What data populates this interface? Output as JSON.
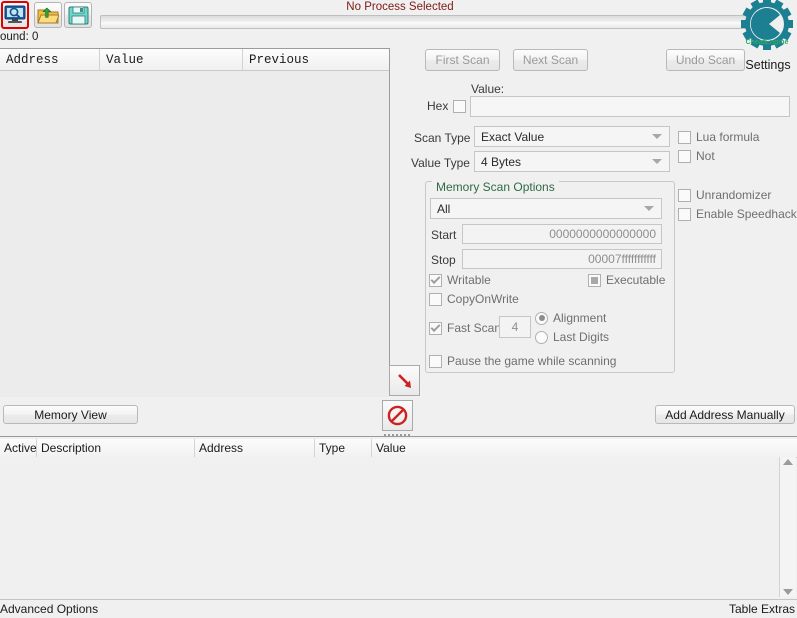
{
  "window": {
    "process_status": "No Process Selected",
    "found_label": "ound: 0",
    "settings_label": "Settings"
  },
  "toolbar": {
    "icons": [
      {
        "name": "open-process-icon",
        "label": "Open Process"
      },
      {
        "name": "open-file-icon",
        "label": "Open File"
      },
      {
        "name": "save-file-icon",
        "label": "Save File"
      }
    ]
  },
  "scan_results": {
    "columns": [
      "Address",
      "Value",
      "Previous"
    ],
    "rows": []
  },
  "scan_buttons": {
    "first_scan": "First Scan",
    "next_scan": "Next Scan",
    "undo_scan": "Undo Scan"
  },
  "scan_form": {
    "value_label": "Value:",
    "hex_label": "Hex",
    "hex_checked": false,
    "value_input": "",
    "scan_type_label": "Scan Type",
    "scan_type_value": "Exact Value",
    "value_type_label": "Value Type",
    "value_type_value": "4 Bytes",
    "lua_formula_label": "Lua formula",
    "lua_formula_checked": false,
    "not_label": "Not",
    "not_checked": false,
    "unrandomizer_label": "Unrandomizer",
    "unrandomizer_checked": false,
    "enable_speedhack_label": "Enable Speedhack",
    "enable_speedhack_checked": false
  },
  "memory_scan_options": {
    "title": "Memory Scan Options",
    "region_value": "All",
    "start_label": "Start",
    "start_value": "0000000000000000",
    "stop_label": "Stop",
    "stop_value": "00007fffffffffff",
    "writable_label": "Writable",
    "writable_checked": true,
    "executable_label": "Executable",
    "executable_state": "grayfill",
    "copyonwrite_label": "CopyOnWrite",
    "copyonwrite_checked": false,
    "fast_scan_label": "Fast Scan",
    "fast_scan_checked": true,
    "fast_scan_value": "4",
    "alignment_label": "Alignment",
    "alignment_selected": true,
    "last_digits_label": "Last Digits",
    "last_digits_selected": false,
    "pause_game_label": "Pause the game while scanning",
    "pause_game_checked": false
  },
  "middle_buttons": {
    "memory_view": "Memory View",
    "add_address_manually": "Add Address Manually"
  },
  "cheat_table": {
    "columns": [
      "Active",
      "Description",
      "Address",
      "Type",
      "Value"
    ],
    "rows": []
  },
  "status_bar": {
    "advanced_options": "Advanced Options",
    "table_extras": "Table Extras"
  },
  "colors": {
    "accent": "#2a8a9e",
    "process_status": "#7d1a16",
    "group_title": "#2f6b45",
    "danger": "#d32020"
  }
}
